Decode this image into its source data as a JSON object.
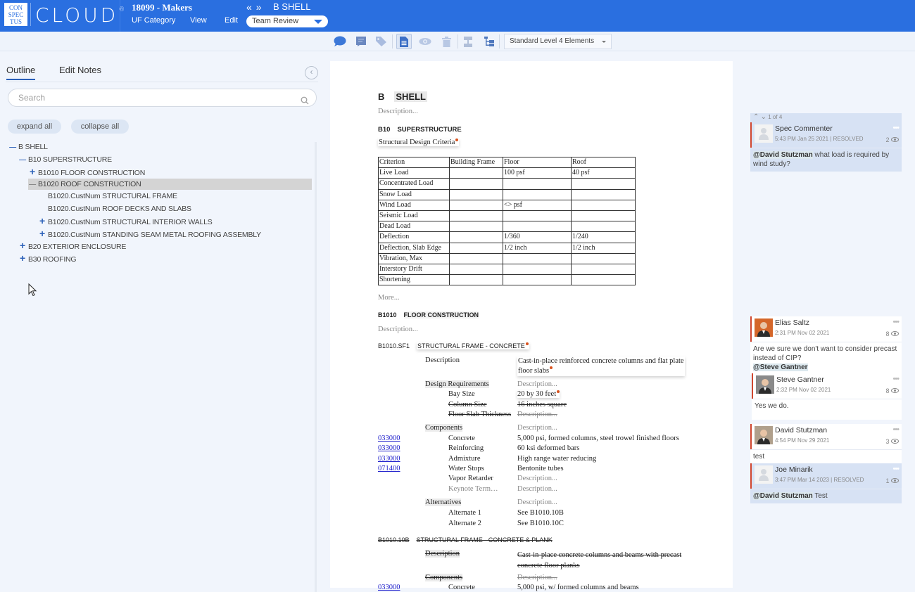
{
  "header": {
    "logo_box_lines": [
      "CON",
      "SPEC",
      "TUS"
    ],
    "logo_word": "CLOUD",
    "logo_reg": "®",
    "project": "18099 - Makers",
    "menu": [
      "UF Category",
      "View",
      "Edit"
    ],
    "nav_prev": "«",
    "nav_next": "»",
    "section": "B SHELL",
    "view_mode": "Team Review"
  },
  "toolbar": {
    "icons": [
      "comment-icon",
      "note-icon",
      "tag-icon",
      "document-icon",
      "eye-icon",
      "trash-icon",
      "split-icon",
      "hierarchy-icon"
    ],
    "level_select": "Standard Level 4 Elements"
  },
  "left_panel": {
    "tabs": [
      "Outline",
      "Edit Notes"
    ],
    "active_tab": "Outline",
    "search_placeholder": "Search",
    "expand_all": "expand all",
    "collapse_all": "collapse all",
    "tree": [
      {
        "label": "B SHELL",
        "toggle": "minus",
        "level": 0
      },
      {
        "label": "B10 SUPERSTRUCTURE",
        "toggle": "minus",
        "level": 1
      },
      {
        "label": "B1010 FLOOR CONSTRUCTION",
        "toggle": "plus",
        "level": 2
      },
      {
        "label": "B1020 ROOF CONSTRUCTION",
        "toggle": "minus",
        "level": 2,
        "selected": true
      },
      {
        "label": "B1020.CustNum STRUCTURAL FRAME",
        "toggle": "",
        "level": 3
      },
      {
        "label": "B1020.CustNum ROOF DECKS AND SLABS",
        "toggle": "",
        "level": 3
      },
      {
        "label": "B1020.CustNum STRUCTURAL INTERIOR WALLS",
        "toggle": "plus",
        "level": 3
      },
      {
        "label": "B1020.CustNum STANDING SEAM METAL ROOFING ASSEMBLY",
        "toggle": "plus",
        "level": 3
      },
      {
        "label": "B20 EXTERIOR ENCLOSURE",
        "toggle": "plus",
        "level": 1
      },
      {
        "label": "B30 ROOFING",
        "toggle": "plus",
        "level": 1
      }
    ]
  },
  "document": {
    "title_code": "B",
    "title_text": "SHELL",
    "description_placeholder": "Description...",
    "b10_code": "B10",
    "b10_title": "SUPERSTRUCTURE",
    "criteria_title": "Structural Design Criteria",
    "criteria_table": {
      "headers": [
        "Criterion",
        "Building Frame",
        "Floor",
        "Roof"
      ],
      "rows": [
        [
          "Live Load",
          "",
          "100 psf",
          "40 psf"
        ],
        [
          "Concentrated Load",
          "",
          "",
          ""
        ],
        [
          "Snow Load",
          "",
          "",
          ""
        ],
        [
          "Wind Load",
          "",
          "<> psf",
          ""
        ],
        [
          "Seismic Load",
          "",
          "",
          ""
        ],
        [
          "Dead Load",
          "",
          "",
          ""
        ],
        [
          "Deflection",
          "",
          "1/360",
          "1/240"
        ],
        [
          "Deflection, Slab Edge",
          "",
          "1/2 inch",
          "1/2 inch"
        ],
        [
          "Vibration, Max",
          "",
          "",
          ""
        ],
        [
          "Interstory Drift",
          "",
          "",
          ""
        ],
        [
          "Shortening",
          "",
          "",
          ""
        ]
      ]
    },
    "more": "More...",
    "b1010_code": "B1010",
    "b1010_title": "FLOOR CONSTRUCTION",
    "sf1_code": "B1010.SF1",
    "sf1_title": "STRUCTURAL FRAME - CONCRETE",
    "sf1": {
      "description_label": "Description",
      "description_line1": "Cast-in-place reinforced concrete columns and flat plate",
      "description_line2": "floor slabs",
      "design_req_label": "Design Requirements",
      "design_reqs": [
        {
          "name": "Bay Size",
          "value": "20 by 30 feet",
          "struck": false,
          "placeholder": false
        },
        {
          "name": "Column Size",
          "value": "16 inches square",
          "struck": true,
          "placeholder": false
        },
        {
          "name": "Floor Slab Thickness",
          "value": "Description...",
          "struck": true,
          "placeholder": true
        }
      ],
      "components_label": "Components",
      "components": [
        {
          "code": "033000",
          "name": "Concrete",
          "value": "5,000 psi, formed columns, steel trowel finished floors"
        },
        {
          "code": "033000",
          "name": "Reinforcing",
          "value": "60 ksi deformed bars"
        },
        {
          "code": "033000",
          "name": "Admixture",
          "value": "High range water reducing"
        },
        {
          "code": "071400",
          "name": "Water Stops",
          "value": "Bentonite tubes"
        },
        {
          "code": "",
          "name": "Vapor Retarder",
          "value": "Description..."
        },
        {
          "code": "",
          "name": "Keynote Term…",
          "value": "Description..."
        }
      ],
      "alternatives_label": "Alternatives",
      "alternatives": [
        {
          "name": "Alternate 1",
          "value": "See B1010.10B"
        },
        {
          "name": "Alternate 2",
          "value": "See B1010.10C"
        }
      ]
    },
    "alt_code": "B1010.10B",
    "alt_title": "STRUCTURAL FRAME - CONCRETE & PLANK",
    "alt": {
      "description_label": "Description",
      "description_line1": "Cast-in-place concrete columns and beams with precast",
      "description_line2": "concrete floor planks",
      "components_label": "Components",
      "component_code": "033000",
      "component_name": "Concrete",
      "component_value": "5,000 psi, w/ formed columns and beams"
    }
  },
  "comments": {
    "pager": "1 of 4",
    "threads": [
      {
        "name": "Spec Commenter",
        "time": "5:43 PM Jan 25 2021 | RESOLVED",
        "views": "2",
        "mention": "@David Stutzman",
        "text": " what load is required by wind study?",
        "resolved": true
      },
      {
        "name": "Elias Saltz",
        "time": "2:31 PM Nov 02 2021",
        "views": "8",
        "text": "Are we sure we don't want to consider precast instead of CIP?",
        "mention": "@Steve Gantner",
        "resolved": false
      },
      {
        "name": "Steve Gantner",
        "time": "2:32 PM Nov 02 2021",
        "views": "8",
        "text": "Yes we do.",
        "resolved": false
      },
      {
        "name": "David Stutzman",
        "time": "4:54 PM Nov 29 2021",
        "views": "3",
        "text": "test",
        "resolved": false
      },
      {
        "name": "Joe Minarik",
        "time": "3:47 PM Mar 14 2023 | RESOLVED",
        "views": "1",
        "mention": "@David Stutzman",
        "text": " Test",
        "resolved": true
      }
    ]
  },
  "colors": {
    "brand_blue": "#2a6fe0",
    "comment_accent": "#d0462e",
    "change_dot": "#d9531e",
    "link": "#2222cc"
  }
}
